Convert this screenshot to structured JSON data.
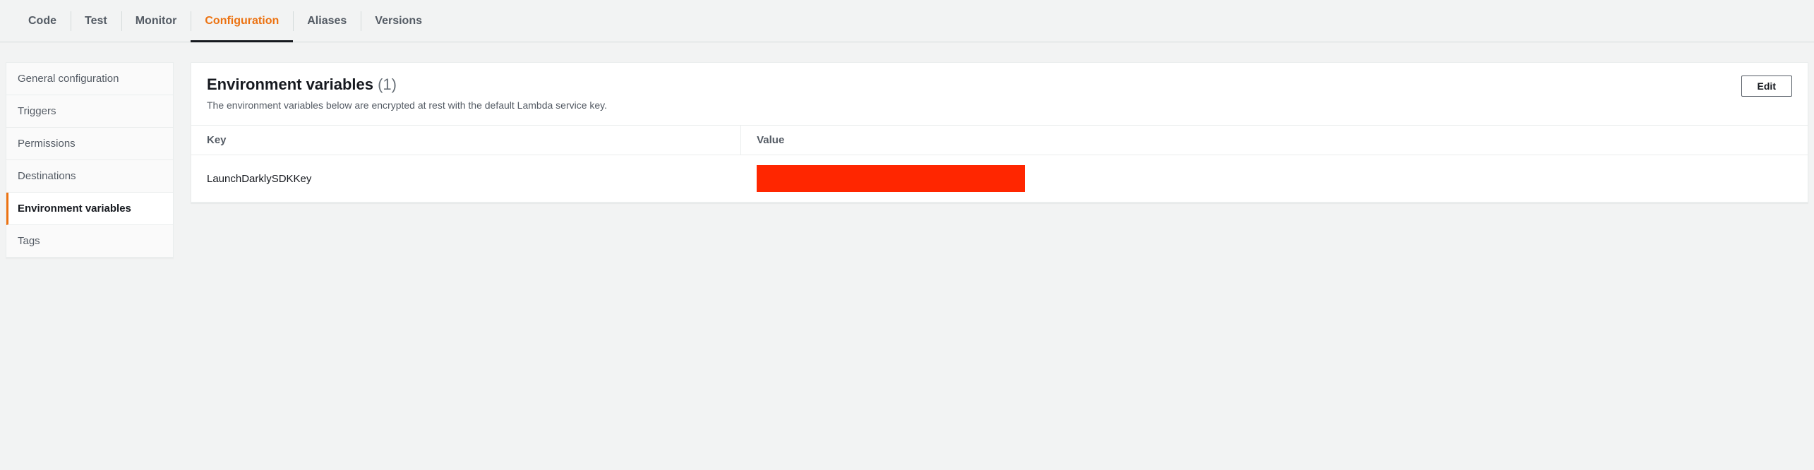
{
  "tabs": {
    "code": "Code",
    "test": "Test",
    "monitor": "Monitor",
    "configuration": "Configuration",
    "aliases": "Aliases",
    "versions": "Versions",
    "active": "configuration"
  },
  "sidebar": {
    "items": [
      {
        "label": "General configuration"
      },
      {
        "label": "Triggers"
      },
      {
        "label": "Permissions"
      },
      {
        "label": "Destinations"
      },
      {
        "label": "Environment variables"
      },
      {
        "label": "Tags"
      }
    ],
    "selected_index": 4
  },
  "panel": {
    "title": "Environment variables",
    "count_label": "(1)",
    "description": "The environment variables below are encrypted at rest with the default Lambda service key.",
    "edit_label": "Edit",
    "table": {
      "headers": {
        "key": "Key",
        "value": "Value"
      },
      "rows": [
        {
          "key": "LaunchDarklySDKKey",
          "value_redacted": true
        }
      ]
    }
  }
}
